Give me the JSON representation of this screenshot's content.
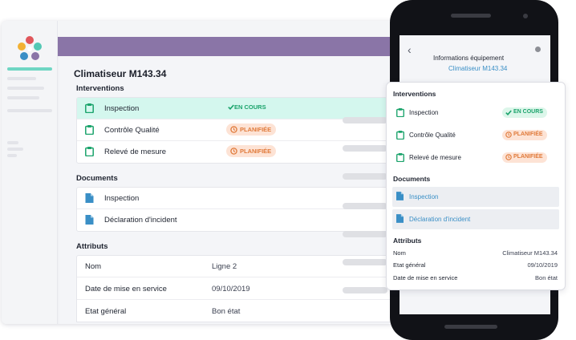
{
  "desktop": {
    "title": "Climatiseur M143.34",
    "interventions_heading": "Interventions",
    "interventions": [
      {
        "label": "Inspection",
        "status": "EN COURS",
        "status_type": "green",
        "active": true
      },
      {
        "label": "Contrôle Qualité",
        "status": "PLANIFIÉE",
        "status_type": "orange",
        "active": false
      },
      {
        "label": "Relevé de mesure",
        "status": "PLANIFIÉE",
        "status_type": "orange",
        "active": false
      }
    ],
    "documents_heading": "Documents",
    "documents": [
      {
        "label": "Inspection"
      },
      {
        "label": "Déclaration d'incident"
      }
    ],
    "attributes_heading": "Attributs",
    "attributes": [
      {
        "key": "Nom",
        "value": "Ligne 2"
      },
      {
        "key": "Date de mise en service",
        "value": "09/10/2019"
      },
      {
        "key": "Etat général",
        "value": "Bon état"
      }
    ]
  },
  "mobile": {
    "header_title": "Informations équipement",
    "header_subtitle": "Climatiseur M143.34",
    "interventions_heading": "Interventions",
    "interventions": [
      {
        "label": "Inspection",
        "status": "EN COURS",
        "status_type": "green"
      },
      {
        "label": "Contrôle Qualité",
        "status": "PLANIFIÉE",
        "status_type": "orange"
      },
      {
        "label": "Relevé de mesure",
        "status": "PLANIFIÉE",
        "status_type": "orange"
      }
    ],
    "documents_heading": "Documents",
    "documents": [
      {
        "label": "Inspection"
      },
      {
        "label": "Déclaration d'incident"
      }
    ],
    "attributes_heading": "Attributs",
    "attributes": [
      {
        "key": "Nom",
        "value": "Climatiseur M143.34"
      },
      {
        "key": "Etat général",
        "value": "09/10/2019"
      },
      {
        "key": "Date de mise en service",
        "value": "Bon état"
      }
    ]
  },
  "colors": {
    "accent_purple": "#8a75a7",
    "active_row": "#d4f7ee",
    "status_green": "#1aa36b",
    "status_orange": "#e07a3a",
    "link_blue": "#3a8fc6"
  },
  "icons": [
    "app-logo",
    "clipboard-icon",
    "document-icon",
    "check-icon",
    "clock-icon",
    "back-arrow-icon"
  ]
}
